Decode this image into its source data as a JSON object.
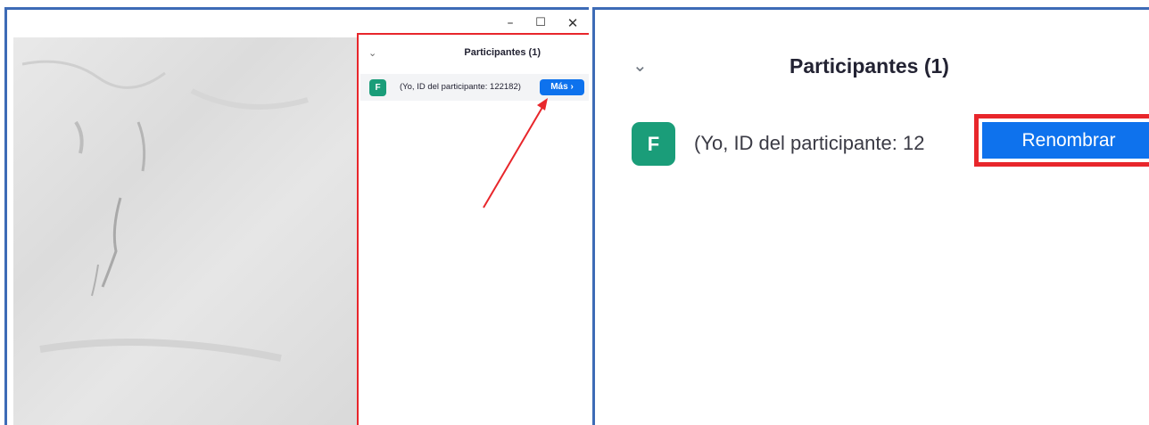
{
  "window": {
    "minimize_glyph": "–",
    "maximize_glyph": "☐",
    "close_glyph": "✕"
  },
  "panel": {
    "collapse_glyph": "⌄",
    "title": "Participantes (1)"
  },
  "participant": {
    "initial": "F",
    "label_full": "(Yo, ID del participante: 122182)",
    "label_truncated": "(Yo, ID del participante: 12",
    "more_button": "Más ›",
    "avatar_color": "#1a9d79"
  },
  "zoom": {
    "rename_button": "Renombrar"
  },
  "colors": {
    "accent_blue": "#0e72ed",
    "highlight_red": "#e8262b",
    "frame_blue": "#3d6bb6"
  }
}
